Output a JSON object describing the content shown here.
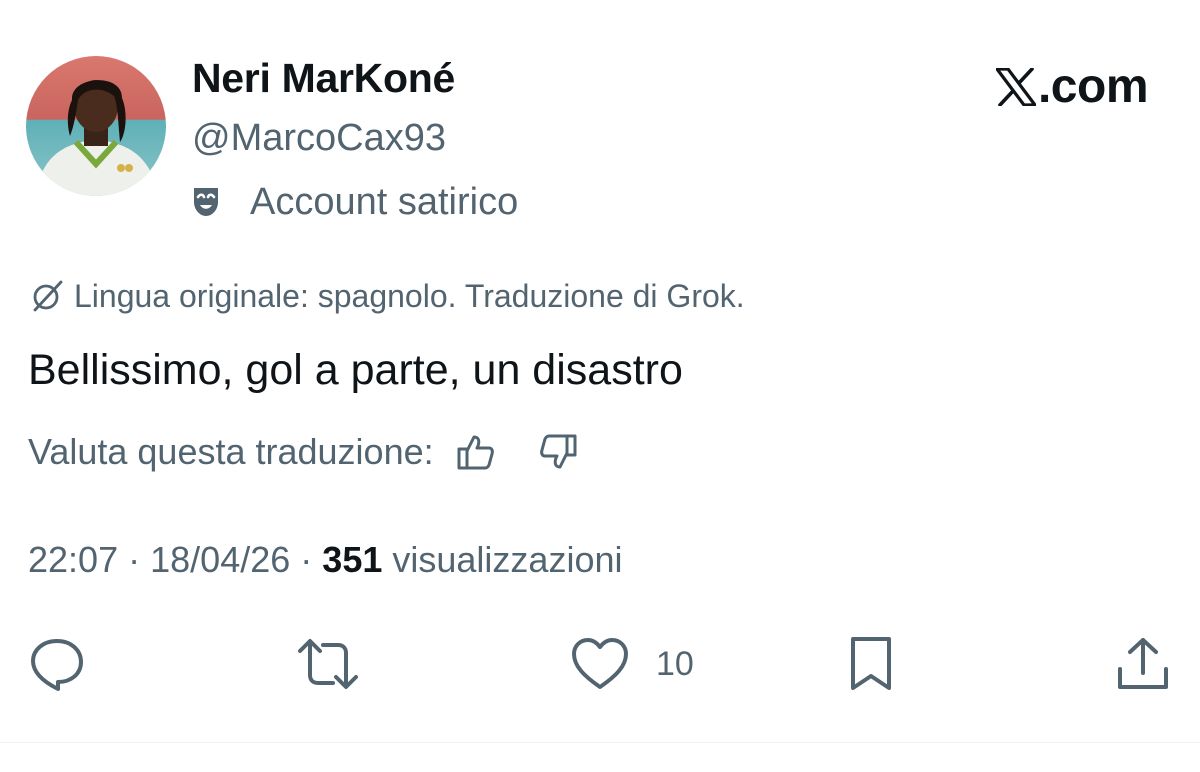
{
  "author": {
    "display_name": "Neri MarKoné",
    "handle": "@MarcoCax93",
    "account_label": "Account satirico"
  },
  "brand": {
    "site": ".com"
  },
  "translation": {
    "note": "Lingua originale: spagnolo. Traduzione di Grok.",
    "rate_prompt": "Valuta questa traduzione:"
  },
  "tweet": {
    "text": "Bellissimo, gol a parte, un disastro",
    "time": "22:07",
    "date": "18/04/26",
    "views_count": "351",
    "views_label": "visualizzazioni",
    "separator": "·"
  },
  "actions": {
    "like_count": "10"
  },
  "icons": {
    "account_label": "theater-mask-icon",
    "translation": "grok-icon",
    "rate_up": "thumbs-up-icon",
    "rate_down": "thumbs-down-icon",
    "reply": "reply-icon",
    "repost": "repost-icon",
    "like": "heart-icon",
    "bookmark": "bookmark-icon",
    "share": "share-icon",
    "brand": "x-logo-icon"
  },
  "colors": {
    "text_primary": "#0f1419",
    "text_secondary": "#536471",
    "divider": "#eff3f4"
  }
}
